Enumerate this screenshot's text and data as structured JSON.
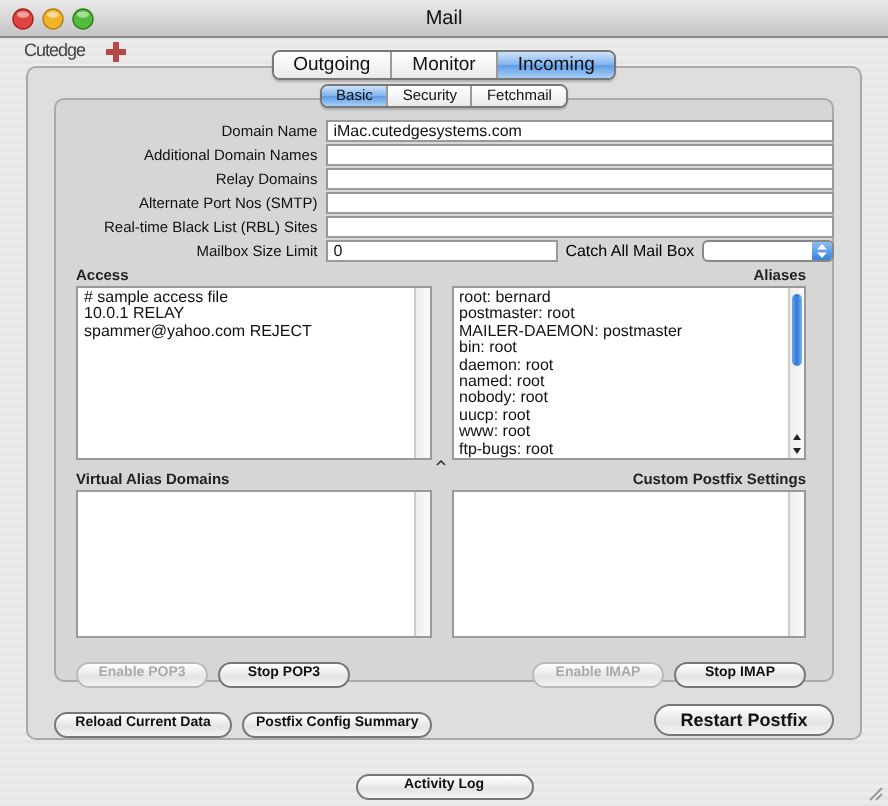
{
  "window": {
    "title": "Mail"
  },
  "logo": {
    "text": "Cutedge"
  },
  "tabs": [
    {
      "label": "Outgoing",
      "selected": false
    },
    {
      "label": "Monitor",
      "selected": false
    },
    {
      "label": "Incoming",
      "selected": true
    }
  ],
  "subtabs": [
    {
      "label": "Basic",
      "selected": true
    },
    {
      "label": "Security",
      "selected": false
    },
    {
      "label": "Fetchmail",
      "selected": false
    }
  ],
  "fields": [
    {
      "label": "Domain Name",
      "value": "iMac.cutedgesystems.com"
    },
    {
      "label": "Additional Domain Names"
    },
    {
      "label": "Relay Domains"
    },
    {
      "label": "Alternate Port Nos (SMTP)"
    },
    {
      "label": "Real-time Black List (RBL) Sites"
    }
  ],
  "mailbox_size_limit": {
    "label": "Mailbox Size Limit",
    "value": "0"
  },
  "catch_all_mail_box": {
    "label": "Catch All Mail Box"
  },
  "lists": [
    {
      "title": "Access",
      "lines": [
        "# sample access file",
        "10.0.1 RELAY",
        "spammer@yahoo.com REJECT"
      ]
    },
    {
      "title": "Aliases",
      "lines": [
        "root: bernard",
        "postmaster: root",
        "MAILER-DAEMON: postmaster",
        "bin: root",
        "daemon: root",
        "named: root",
        "nobody: root",
        "uucp: root",
        "www: root",
        "ftp-bugs: root"
      ]
    },
    {
      "title": "Virtual Alias Domains"
    },
    {
      "title": "Custom Postfix Settings"
    }
  ],
  "service_buttons": [
    {
      "label": "Enable POP3",
      "disabled": true
    },
    {
      "label": "Stop POP3",
      "disabled": false
    },
    {
      "label": "Enable IMAP",
      "disabled": true
    },
    {
      "label": "Stop IMAP",
      "disabled": false
    }
  ],
  "actions": [
    {
      "label": "Reload Current Data",
      "kind": "small"
    },
    {
      "label": "Postfix Config Summary",
      "kind": "small"
    },
    {
      "label": "Restart Postfix",
      "kind": "large"
    }
  ],
  "activity_log_button": {
    "label": "Activity Log"
  }
}
